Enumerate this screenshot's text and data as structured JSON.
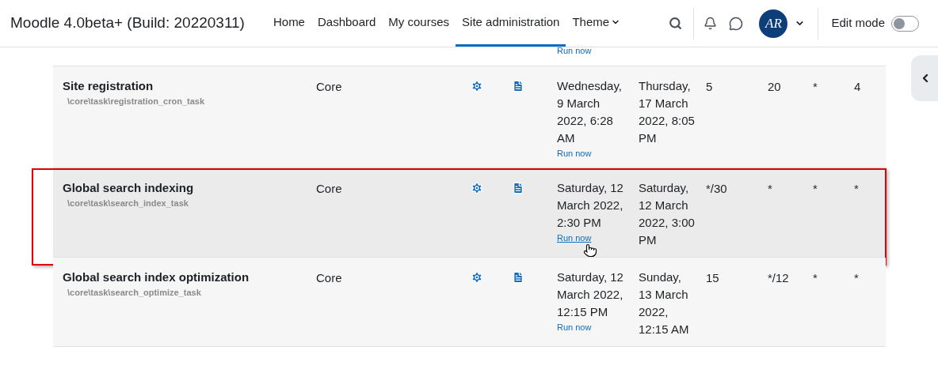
{
  "brand": "Moodle 4.0beta+ (Build: 20220311)",
  "nav": [
    {
      "label": "Home",
      "selected": false,
      "dropdown": false
    },
    {
      "label": "Dashboard",
      "selected": false,
      "dropdown": false
    },
    {
      "label": "My courses",
      "selected": false,
      "dropdown": false
    },
    {
      "label": "Site administration",
      "selected": true,
      "dropdown": false
    },
    {
      "label": "Theme",
      "selected": false,
      "dropdown": true
    }
  ],
  "user": {
    "initials": "AR"
  },
  "edit_mode": {
    "label": "Edit mode",
    "on": false
  },
  "partial_row": {
    "run_now": "Run now"
  },
  "rows": [
    {
      "name": "Site registration",
      "classname": "\\core\\task\\registration_cron_task",
      "component": "Core",
      "last_run": "Wednesday, 9 March 2022, 6:28 AM",
      "run_now": "Run now",
      "next_run": "Thursday, 17 March 2022, 8:05 PM",
      "cells": [
        "5",
        "20",
        "*",
        "4"
      ],
      "highlighted": false,
      "hovered": false
    },
    {
      "name": "Global search indexing",
      "classname": "\\core\\task\\search_index_task",
      "component": "Core",
      "last_run": "Saturday, 12 March 2022, 2:30 PM",
      "run_now": "Run now",
      "next_run": "Saturday, 12 March 2022, 3:00 PM",
      "cells": [
        "*/30",
        "*",
        "*",
        "*"
      ],
      "highlighted": true,
      "hovered": true
    },
    {
      "name": "Global search index optimization",
      "classname": "\\core\\task\\search_optimize_task",
      "component": "Core",
      "last_run": "Saturday, 12 March 2022, 12:15 PM",
      "run_now": "Run now",
      "next_run": "Sunday, 13 March 2022, 12:15 AM",
      "cells": [
        "15",
        "*/12",
        "*",
        "*"
      ],
      "highlighted": false,
      "hovered": false
    }
  ]
}
